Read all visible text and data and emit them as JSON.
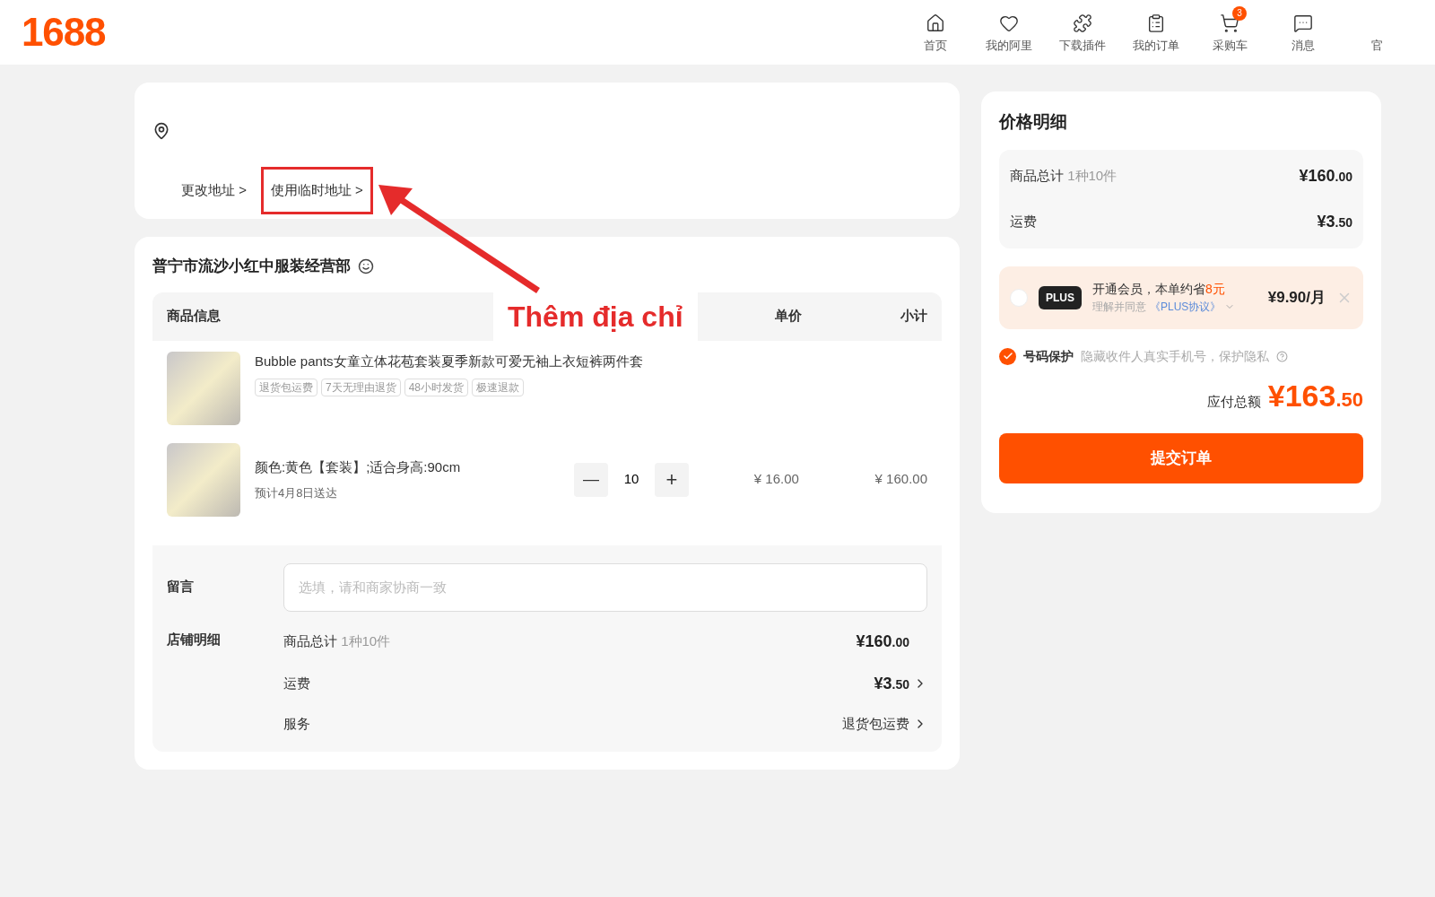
{
  "header": {
    "logo": "1688",
    "nav": [
      {
        "label": "首页"
      },
      {
        "label": "我的阿里"
      },
      {
        "label": "下载插件"
      },
      {
        "label": "我的订单"
      },
      {
        "label": "采购车",
        "badge": "3"
      },
      {
        "label": "消息"
      },
      {
        "label": "官"
      }
    ]
  },
  "address": {
    "links": [
      {
        "label": "更改地址 >",
        "highlighted": false
      },
      {
        "label": "使用临时地址 >",
        "highlighted": true
      }
    ]
  },
  "shop": {
    "name": "普宁市流沙小红中服装经营部",
    "columns": [
      "商品信息",
      "单价",
      "小计"
    ],
    "product": {
      "title": "Bubble pants女童立体花苞套装夏季新款可爱无袖上衣短裤两件套",
      "tags": [
        "退货包运费",
        "7天无理由退货",
        "48小时发货",
        "极速退款"
      ]
    },
    "variant": {
      "spec": "颜色:黄色【套装】;适合身高:90cm",
      "delivery": "预计4月8日送达",
      "minus": "—",
      "quantity": "10",
      "plus": "+",
      "unit_price": "¥ 16.00",
      "subtotal": "¥ 160.00"
    },
    "note": {
      "label": "留言",
      "placeholder": "选填，请和商家协商一致"
    },
    "details": {
      "label": "店铺明细",
      "rows": [
        {
          "label": "商品总计",
          "sub": "1种10件",
          "value": "¥160",
          "decimals": ".00",
          "chevron": false
        },
        {
          "label": "运费",
          "value": "¥3",
          "decimals": ".50",
          "chevron": true
        },
        {
          "label": "服务",
          "value": "退货包运费",
          "chevron": true
        }
      ]
    }
  },
  "annotation": {
    "text": "Thêm địa chỉ"
  },
  "price_panel": {
    "title": "价格明细",
    "rows": [
      {
        "label": "商品总计",
        "sub": "1种10件",
        "value": "¥160",
        "decimals": ".00"
      },
      {
        "label": "运费",
        "value": "¥3",
        "decimals": ".50"
      }
    ],
    "plus": {
      "checked": false,
      "badge": "PLUS",
      "title": "开通会员，本单约省**8元**",
      "agree": "理解并同意",
      "link": "《PLUS协议》",
      "price": "¥9.90/月"
    },
    "protection": {
      "checked": true,
      "label": "号码保护",
      "desc": "隐藏收件人真实手机号，保护隐私"
    },
    "total_label": "应付总额",
    "total": "¥163",
    "total_decimals": ".50",
    "submit": "提交订单"
  }
}
